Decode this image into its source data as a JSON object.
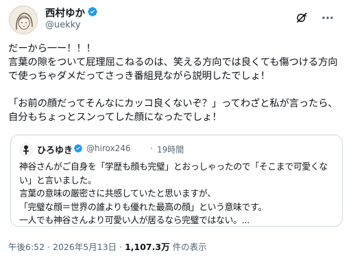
{
  "author": {
    "display_name": "西村ゆか",
    "handle": "@uekky"
  },
  "tweet": {
    "text": "だーから一ー！！！\n言葉の隙をついて屁理屈こねるのは、笑える方向では良くても傷つける方向で使っちゃダメだってさっき番組見ながら説明したでしょ！\n\n「お前の顔だってそんなにカッコ良くないぞ？」ってわざと私が言ったら、自分もちょっとスンってした顔になったでしょ！"
  },
  "quote": {
    "display_name": "ひろゆき",
    "handle": "@hirox246",
    "separator": "·",
    "time": "19時間",
    "text": "神谷さんがご自身を「学歴も顔も完璧」とおっしゃったので「そこまで可愛くない」と言いました。\n言葉の意味の厳密さに共感していたと思いますが、\n「完璧な顔＝世界の誰よりも優れた最高の顔」という意味です。\n一人でも神谷さんより可愛い人が居るなら完璧ではない。..."
  },
  "meta": {
    "timestamp": "午後6:52 · 2026年5月13日 · ",
    "views_count": "1,107.3万",
    "views_label": " 件の表示"
  },
  "icons": {
    "verified": "verified-badge-icon",
    "grok": "grok-icon",
    "more": "more-options-icon"
  },
  "colors": {
    "verified_blue": "#1d9bf0",
    "secondary_text": "#536471",
    "border": "#cfd9de"
  }
}
